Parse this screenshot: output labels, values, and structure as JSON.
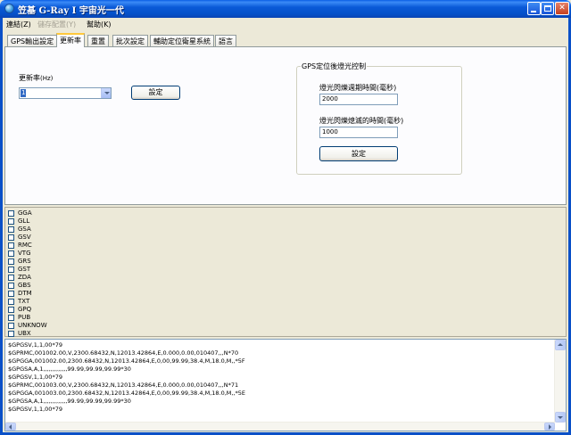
{
  "window": {
    "title": "笠基 G-Ray I 宇宙光一代",
    "minimize_glyph": "",
    "maximize_glyph": "",
    "close_glyph": "✕"
  },
  "menu": [
    {
      "label": "連結(Z)",
      "enabled": true
    },
    {
      "label": "儲存配置(Y)",
      "enabled": false
    },
    {
      "label": "幫助(K)",
      "enabled": true
    }
  ],
  "tabs": [
    {
      "label": "GPS輸出設定",
      "active": false
    },
    {
      "label": "更新率",
      "active": true
    },
    {
      "label": "重置",
      "active": false
    },
    {
      "label": "批次設定",
      "active": false
    },
    {
      "label": "輔助定位衛星系統",
      "active": false
    },
    {
      "label": "語言",
      "active": false
    }
  ],
  "rate": {
    "label": "更新率",
    "unit": "(Hz)",
    "selected": "1",
    "button": "設定"
  },
  "blink_group": {
    "title": "GPS定位後燈光控制",
    "period_label": "燈光閃爍週期時間(毫秒)",
    "period_value": "2000",
    "off_label": "燈光閃爍熄滅的時間(毫秒)",
    "off_value": "1000",
    "button": "設定"
  },
  "sentences": [
    "GGA",
    "GLL",
    "GSA",
    "GSV",
    "RMC",
    "VTG",
    "GRS",
    "GST",
    "ZDA",
    "GBS",
    "DTM",
    "TXT",
    "GPQ",
    "PUB",
    "UNKNOW",
    "UBX"
  ],
  "log": [
    "$GPGSV,1,1,00*79",
    "$GPRMC,001002.00,V,2300.68432,N,12013.42864,E,0.000,0.00,010407,,,N*70",
    "$GPGGA,001002.00,2300.68432,N,12013.42864,E,0,00,99.99,38.4,M,18.0,M,,*5F",
    "$GPGSA,A,1,,,,,,,,,,,,,99.99,99.99,99.99*30",
    "$GPGSV,1,1,00*79",
    "$GPRMC,001003.00,V,2300.68432,N,12013.42864,E,0.000,0.00,010407,,,N*71",
    "$GPGGA,001003.00,2300.68432,N,12013.42864,E,0,00,99.99,38.4,M,18.0,M,,*5E",
    "$GPGSA,A,1,,,,,,,,,,,,,99.99,99.99,99.99*30",
    "$GPGSV,1,1,00*79"
  ]
}
